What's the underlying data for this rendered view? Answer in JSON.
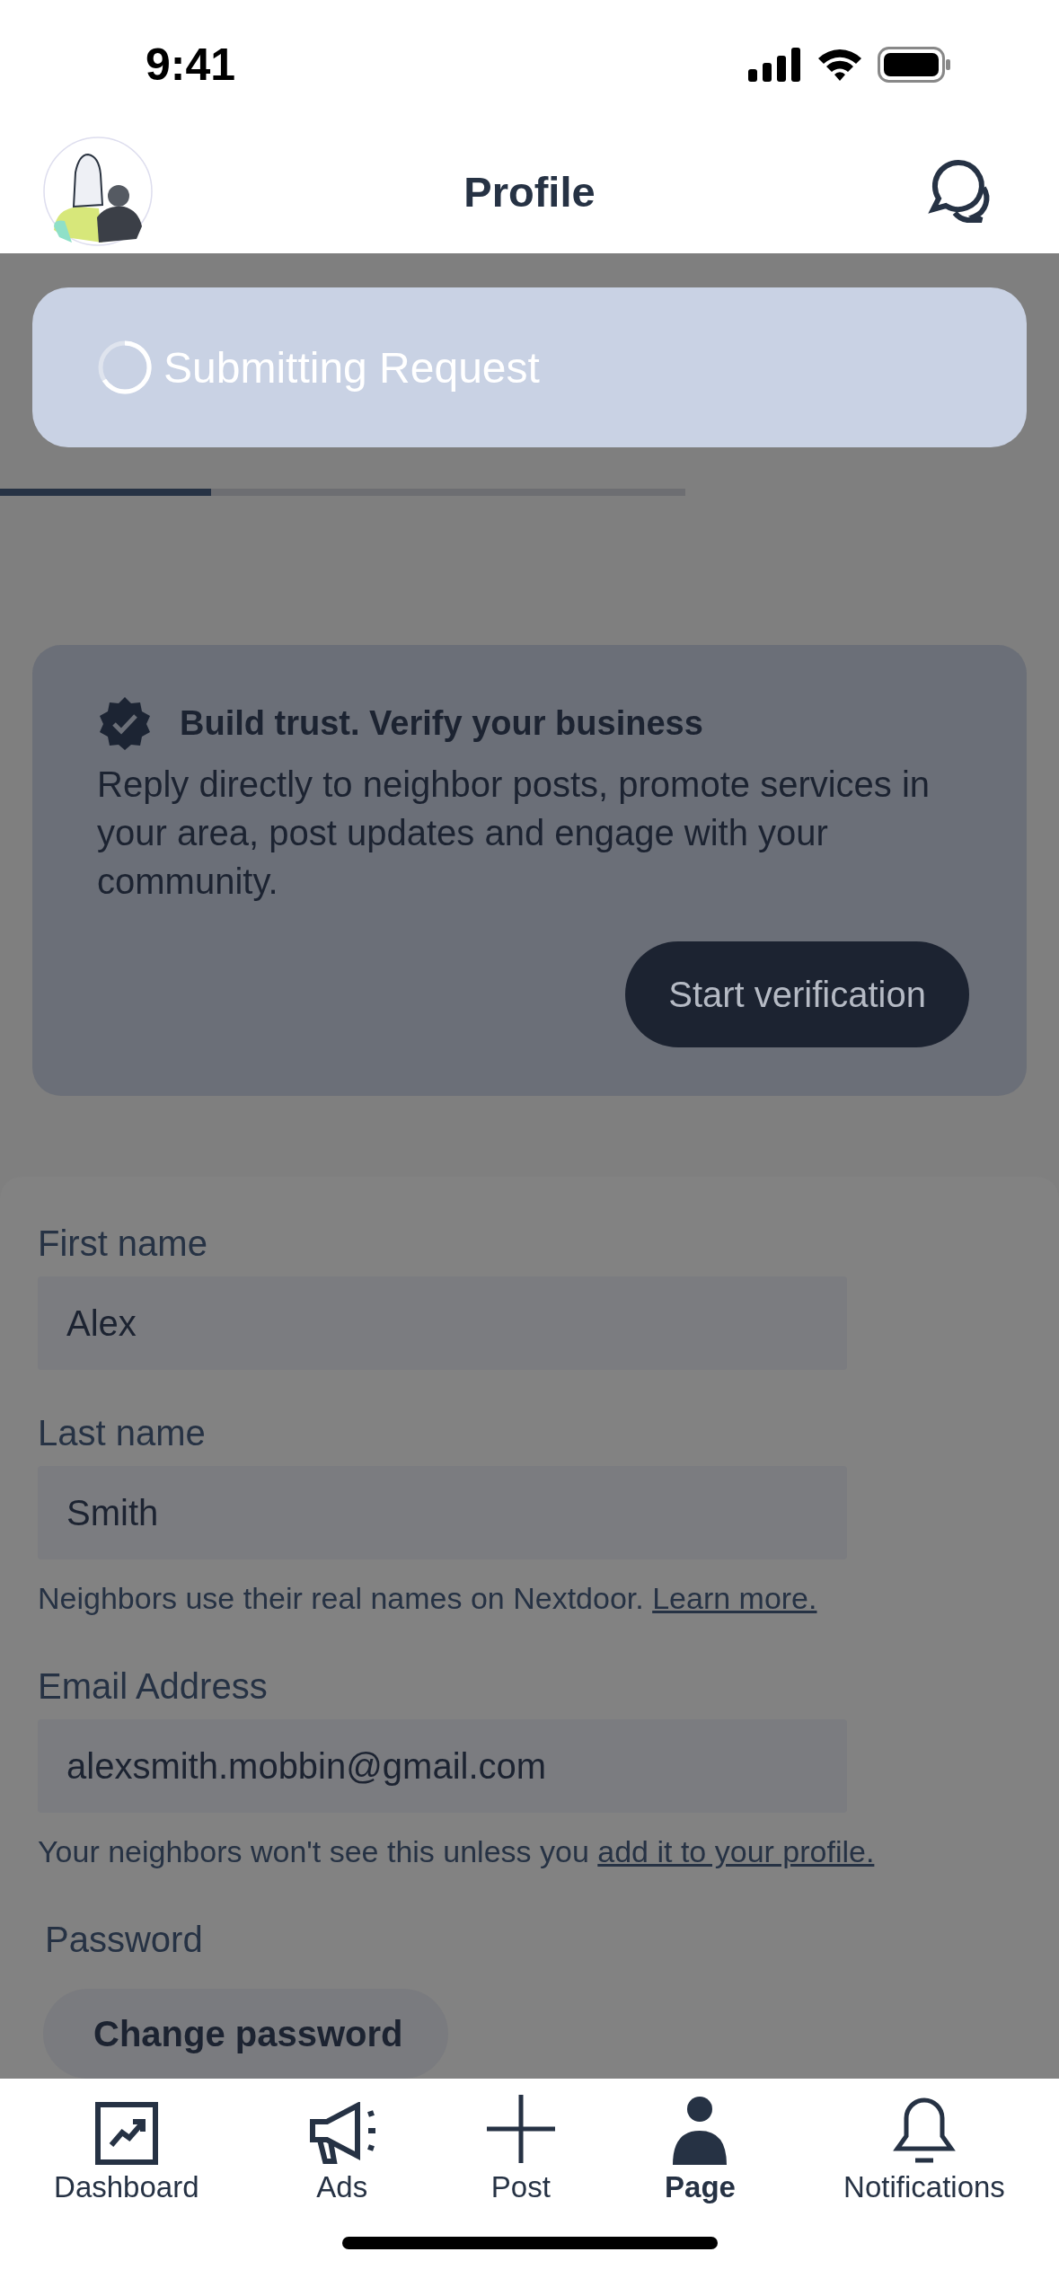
{
  "status_bar": {
    "time": "9:41"
  },
  "header": {
    "title": "Profile"
  },
  "toast": {
    "message": "Submitting Request"
  },
  "tabs": [
    {
      "selected": true
    },
    {
      "selected": false
    },
    {
      "selected": false
    }
  ],
  "verify_card": {
    "title": "Build trust. Verify your business",
    "body": "Reply directly to neighbor posts, promote services in your area, post updates and engage with your community.",
    "button": "Start verification"
  },
  "form": {
    "fields": [
      {
        "label": "First name",
        "value": "Alex"
      },
      {
        "label": "Last name",
        "value": "Smith",
        "hint": "Neighbors use their real names on Nextdoor.",
        "hint_link": "Learn more."
      },
      {
        "label": "Email Address",
        "value": "alexsmith.mobbin@gmail.com",
        "hint": "Your neighbors won't see this unless you",
        "hint_link": "add it to your profile."
      }
    ],
    "password_label": "Password",
    "password_button": "Change password"
  },
  "bottom_nav": [
    {
      "label": "Dashboard",
      "kind": "chart",
      "selected": false
    },
    {
      "label": "Ads",
      "kind": "megaphone",
      "selected": false
    },
    {
      "label": "Post",
      "kind": "plus",
      "selected": false
    },
    {
      "label": "Page",
      "kind": "person",
      "selected": true
    },
    {
      "label": "Notifications",
      "kind": "bell",
      "selected": false
    }
  ]
}
